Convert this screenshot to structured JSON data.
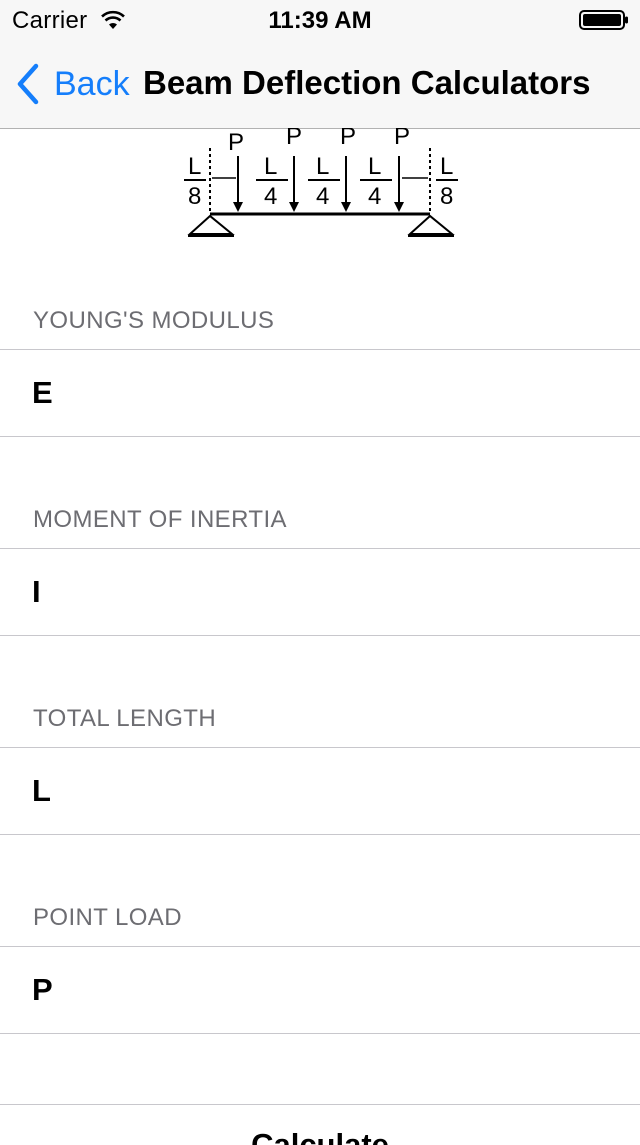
{
  "status_bar": {
    "carrier": "Carrier",
    "time": "11:39 AM"
  },
  "nav": {
    "back_label": "Back",
    "title": "Beam Deflection Calculators"
  },
  "diagram": {
    "load_labels": [
      "P",
      "P",
      "P",
      "P"
    ],
    "dimension_labels": [
      {
        "num": "L",
        "den": "8"
      },
      {
        "num": "L",
        "den": "4"
      },
      {
        "num": "L",
        "den": "4"
      },
      {
        "num": "L",
        "den": "4"
      },
      {
        "num": "L",
        "den": "8"
      }
    ]
  },
  "fields": [
    {
      "header": "YOUNG'S MODULUS",
      "placeholder": "E",
      "value": ""
    },
    {
      "header": "MOMENT OF INERTIA",
      "placeholder": "I",
      "value": ""
    },
    {
      "header": "TOTAL LENGTH",
      "placeholder": "L",
      "value": ""
    },
    {
      "header": "POINT LOAD",
      "placeholder": "P",
      "value": ""
    }
  ],
  "calculate_label": "Calculate",
  "colors": {
    "accent": "#157efb",
    "bar_background": "#f7f7f7",
    "separator": "#c8c7cc",
    "section_header": "#6d6d72"
  }
}
